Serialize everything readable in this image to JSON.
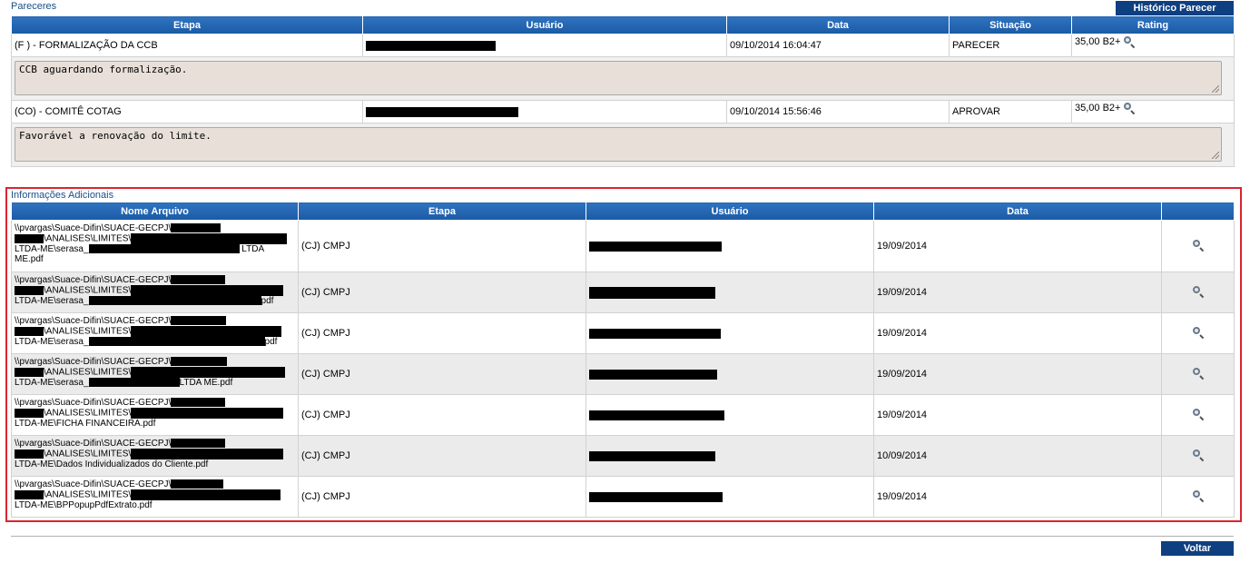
{
  "pareceres": {
    "title": "Pareceres",
    "historico_label": "Histórico Parecer",
    "columns": [
      "Etapa",
      "Usuário",
      "Data",
      "Situação",
      "Rating"
    ],
    "rows": [
      {
        "etapa": "(F ) - FORMALIZAÇÃO DA CCB",
        "data": "09/10/2014 16:04:47",
        "situacao": "PARECER",
        "rating": "35,00 B2+",
        "comment": "CCB aguardando formalização."
      },
      {
        "etapa": "(CO) - COMITÊ COTAG",
        "data": "09/10/2014 15:56:46",
        "situacao": "APROVAR",
        "rating": "35,00 B2+",
        "comment": "Favorável a renovação do limite."
      }
    ]
  },
  "info": {
    "title": "Informações Adicionais",
    "columns": [
      "Nome Arquivo",
      "Etapa",
      "Usuário",
      "Data",
      ""
    ],
    "rows": [
      {
        "l1": "\\\\pvargas\\Suace-Difin\\SUACE-GECPJ\\",
        "l2": "\\ANALISES\\LIMITES\\",
        "l3a": "LTDA-ME\\serasa_",
        "l3b": " LTDA",
        "l4": "ME.pdf",
        "etapa": "(CJ) CMPJ",
        "data": "19/09/2014"
      },
      {
        "l1": "\\\\pvargas\\Suace-Difin\\SUACE-GECPJ\\",
        "l2": "\\ANALISES\\LIMITES\\",
        "l3a": "LTDA-ME\\serasa_",
        "l3b": "pdf",
        "etapa": "(CJ) CMPJ",
        "data": "19/09/2014"
      },
      {
        "l1": "\\\\pvargas\\Suace-Difin\\SUACE-GECPJ\\",
        "l2": "\\ANALISES\\LIMITES\\",
        "l3a": "LTDA-ME\\serasa_",
        "l3b": "pdf",
        "etapa": "(CJ) CMPJ",
        "data": "19/09/2014"
      },
      {
        "l1": "\\\\pvargas\\Suace-Difin\\SUACE-GECPJ\\",
        "l2": "\\ANALISES\\LIMITES\\",
        "l3a": "LTDA-ME\\serasa_",
        "l3b": "LTDA ME.pdf",
        "etapa": "(CJ) CMPJ",
        "data": "19/09/2014"
      },
      {
        "l1": "\\\\pvargas\\Suace-Difin\\SUACE-GECPJ\\",
        "l2": "\\ANALISES\\LIMITES\\",
        "l3a": "LTDA-ME\\FICHA FINANCEIRA.pdf",
        "etapa": "(CJ) CMPJ",
        "data": "19/09/2014"
      },
      {
        "l1": "\\\\pvargas\\Suace-Difin\\SUACE-GECPJ\\",
        "l2": "\\ANALISES\\LIMITES\\",
        "l3a": "LTDA-ME\\Dados Individualizados do Cliente.pdf",
        "etapa": "(CJ) CMPJ",
        "data": "10/09/2014"
      },
      {
        "l1": "\\\\pvargas\\Suace-Difin\\SUACE-GECPJ\\",
        "l2": "\\ANALISES\\LIMITES\\",
        "l3a": "LTDA-ME\\BPPopupPdfExtrato.pdf",
        "etapa": "(CJ) CMPJ",
        "data": "19/09/2014"
      }
    ]
  },
  "footer": {
    "voltar_label": "Voltar"
  },
  "colors": {
    "header_blue": "#1b5aa5",
    "button_navy": "#0e3f80",
    "highlight_red": "#d9252f",
    "comment_bg": "#e8e0d8"
  }
}
